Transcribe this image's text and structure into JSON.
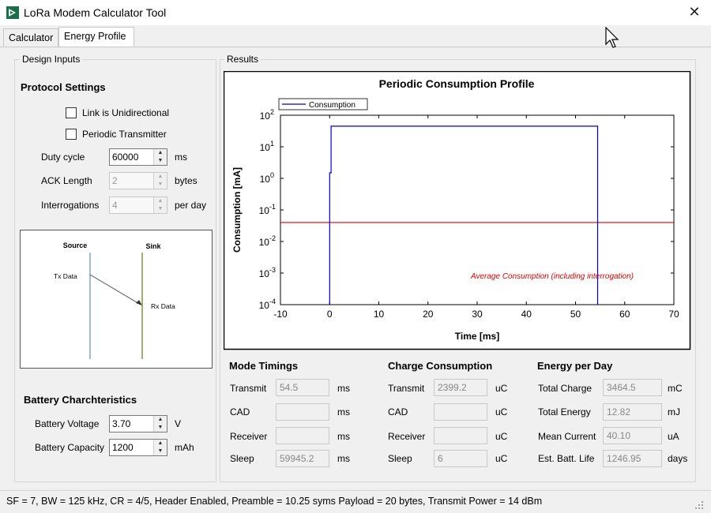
{
  "window": {
    "title": "LoRa Modem Calculator Tool",
    "icon": "app-logo-icon",
    "close_icon": "close-icon"
  },
  "tabs": [
    {
      "label": "Calculator",
      "active": false
    },
    {
      "label": "Energy Profile",
      "active": true
    }
  ],
  "design_inputs": {
    "caption": "Design Inputs",
    "protocol_heading": "Protocol Settings",
    "link_unidirectional": {
      "label": "Link is Unidirectional",
      "checked": false
    },
    "periodic_transmitter": {
      "label": "Periodic Transmitter",
      "checked": false
    },
    "duty_cycle": {
      "label": "Duty cycle",
      "value": "60000",
      "unit": "ms"
    },
    "ack_length": {
      "label": "ACK Length",
      "value": "2",
      "unit": "bytes"
    },
    "interrogations": {
      "label": "Interrogations",
      "value": "4",
      "unit": "per day"
    },
    "diagram": {
      "source": "Source",
      "sink": "Sink",
      "tx": "Tx Data",
      "rx": "Rx Data"
    },
    "battery_heading": "Battery Charchteristics",
    "battery_voltage": {
      "label": "Battery Voltage",
      "value": "3.70",
      "unit": "V"
    },
    "battery_capacity": {
      "label": "Battery Capacity",
      "value": "1200",
      "unit": "mAh"
    }
  },
  "results": {
    "caption": "Results",
    "mode_timings": {
      "heading": "Mode Timings",
      "rows": [
        {
          "label": "Transmit",
          "value": "54.5",
          "unit": "ms"
        },
        {
          "label": "CAD",
          "value": "",
          "unit": "ms"
        },
        {
          "label": "Receiver",
          "value": "",
          "unit": "ms"
        },
        {
          "label": "Sleep",
          "value": "59945.2",
          "unit": "ms"
        }
      ]
    },
    "charge_consumption": {
      "heading": "Charge Consumption",
      "rows": [
        {
          "label": "Transmit",
          "value": "2399.2",
          "unit": "uC"
        },
        {
          "label": "CAD",
          "value": "",
          "unit": "uC"
        },
        {
          "label": "Receiver",
          "value": "",
          "unit": "uC"
        },
        {
          "label": "Sleep",
          "value": "6",
          "unit": "uC"
        }
      ]
    },
    "energy_per_day": {
      "heading": "Energy per Day",
      "rows": [
        {
          "label": "Total Charge",
          "value": "3464.5",
          "unit": "mC"
        },
        {
          "label": "Total Energy",
          "value": "12.82",
          "unit": "mJ"
        },
        {
          "label": "Mean Current",
          "value": "40.10",
          "unit": "uA"
        },
        {
          "label": "Est. Batt. Life",
          "value": "1246.95",
          "unit": "days"
        }
      ]
    }
  },
  "chart_data": {
    "type": "line",
    "title": "Periodic Consumption Profile",
    "xlabel": "Time [ms]",
    "ylabel": "Consumption [mA]",
    "xlim": [
      -10,
      70
    ],
    "ylim": [
      0.0001,
      100
    ],
    "yscale": "log",
    "xticks": [
      "-10",
      "0",
      "10",
      "20",
      "30",
      "40",
      "50",
      "60",
      "70"
    ],
    "yticks": [
      {
        "base": "10",
        "exp": "2"
      },
      {
        "base": "10",
        "exp": "1"
      },
      {
        "base": "10",
        "exp": "0"
      },
      {
        "base": "10",
        "exp": "-1"
      },
      {
        "base": "10",
        "exp": "-2"
      },
      {
        "base": "10",
        "exp": "-3"
      },
      {
        "base": "10",
        "exp": "-4"
      }
    ],
    "legend": "top-left",
    "grid": false,
    "series": [
      {
        "name": "Consumption",
        "color": "#0000cc",
        "x": [
          0.0,
          0.0,
          0.3,
          0.3,
          54.5,
          54.5
        ],
        "y": [
          0.0001,
          1.5,
          1.5,
          45,
          45,
          0.0001
        ]
      }
    ],
    "reference_line": {
      "value": 0.04,
      "color": "#dd0000",
      "annotation": "Average Consumption (including interrogation)"
    }
  },
  "status_bar": {
    "text": "SF = 7,   BW = 125 kHz,   CR = 4/5,   Header Enabled,   Preamble = 10.25 syms   Payload = 20 bytes,   Transmit Power = 14 dBm"
  }
}
